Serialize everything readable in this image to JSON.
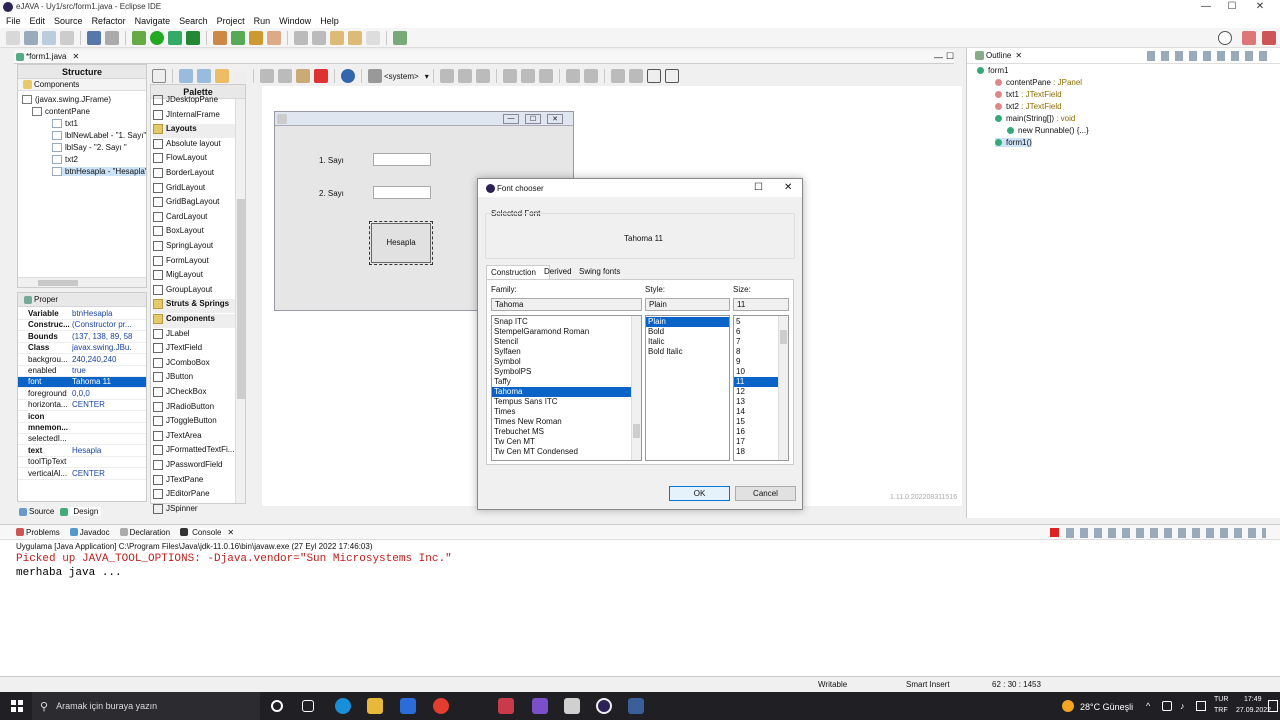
{
  "window": {
    "title": "eJAVA - Uy1/src/form1.java - Eclipse IDE",
    "min": "—",
    "max": "☐",
    "close": "✕"
  },
  "menu": [
    "File",
    "Edit",
    "Source",
    "Refactor",
    "Navigate",
    "Search",
    "Project",
    "Run",
    "Window",
    "Help"
  ],
  "editor_tab": {
    "label": "*form1.java",
    "close": "✕"
  },
  "structure": {
    "title": "Structure",
    "components_label": "Components",
    "tree": [
      "(javax.swing.JFrame)",
      "contentPane",
      "txt1",
      "lblNewLabel - \"1. Sayı\"",
      "lblSay - \"2. Sayı \"",
      "txt2",
      "btnHesapla - \"Hesapla\""
    ]
  },
  "properties": {
    "title": "Proper",
    "rows": [
      {
        "k": "Variable",
        "v": "btnHesapla",
        "bold": true
      },
      {
        "k": "Construc...",
        "v": "(Constructor pr...",
        "bold": true
      },
      {
        "k": "Bounds",
        "v": "(137, 138, 89, 58)",
        "bold": true
      },
      {
        "k": "Class",
        "v": "javax.swing.JBu...",
        "bold": true
      },
      {
        "k": "backgrou...",
        "v": "240,240,240",
        "bold": false
      },
      {
        "k": "enabled",
        "v": "true",
        "bold": false
      },
      {
        "k": "font",
        "v": "Tahoma 11",
        "bold": false,
        "sel": true
      },
      {
        "k": "foreground",
        "v": "0,0,0",
        "bold": false
      },
      {
        "k": "horizonta...",
        "v": "CENTER",
        "bold": false
      },
      {
        "k": "icon",
        "v": "",
        "bold": true
      },
      {
        "k": "mnemon...",
        "v": "",
        "bold": true
      },
      {
        "k": "selectedI...",
        "v": "",
        "bold": false
      },
      {
        "k": "text",
        "v": "Hesapla",
        "bold": true
      },
      {
        "k": "toolTipText",
        "v": "",
        "bold": false
      },
      {
        "k": "verticalAl...",
        "v": "CENTER",
        "bold": false
      }
    ]
  },
  "bottom_tabs": {
    "source": "Source",
    "design": "Design"
  },
  "toolbar_system": "<system>",
  "palette": {
    "title": "Palette",
    "items": [
      {
        "label": "JDesktopPane",
        "cat": false
      },
      {
        "label": "JInternalFrame",
        "cat": false
      },
      {
        "label": "Layouts",
        "cat": true
      },
      {
        "label": "Absolute layout",
        "cat": false
      },
      {
        "label": "FlowLayout",
        "cat": false
      },
      {
        "label": "BorderLayout",
        "cat": false
      },
      {
        "label": "GridLayout",
        "cat": false
      },
      {
        "label": "GridBagLayout",
        "cat": false
      },
      {
        "label": "CardLayout",
        "cat": false
      },
      {
        "label": "BoxLayout",
        "cat": false
      },
      {
        "label": "SpringLayout",
        "cat": false
      },
      {
        "label": "FormLayout",
        "cat": false
      },
      {
        "label": "MigLayout",
        "cat": false
      },
      {
        "label": "GroupLayout",
        "cat": false
      },
      {
        "label": "Struts & Springs",
        "cat": true
      },
      {
        "label": "Components",
        "cat": true
      },
      {
        "label": "JLabel",
        "cat": false
      },
      {
        "label": "JTextField",
        "cat": false
      },
      {
        "label": "JComboBox",
        "cat": false
      },
      {
        "label": "JButton",
        "cat": false
      },
      {
        "label": "JCheckBox",
        "cat": false
      },
      {
        "label": "JRadioButton",
        "cat": false
      },
      {
        "label": "JToggleButton",
        "cat": false
      },
      {
        "label": "JTextArea",
        "cat": false
      },
      {
        "label": "JFormattedTextFi...",
        "cat": false
      },
      {
        "label": "JPasswordField",
        "cat": false
      },
      {
        "label": "JTextPane",
        "cat": false
      },
      {
        "label": "JEditorPane",
        "cat": false
      },
      {
        "label": "JSpinner",
        "cat": false
      }
    ]
  },
  "jframe": {
    "label1": "1. Sayı",
    "label2": "2. Sayı",
    "button": "Hesapla"
  },
  "font_chooser": {
    "title": "Font chooser",
    "selected_font_label": "Selected Font",
    "preview": "Tahoma 11",
    "tabs": [
      "Construction",
      "Derived",
      "Swing fonts"
    ],
    "family_label": "Family:",
    "style_label": "Style:",
    "size_label": "Size:",
    "family_value": "Tahoma",
    "style_value": "Plain",
    "size_value": "11",
    "families": [
      "Snap ITC",
      "StempelGaramond Roman",
      "Stencil",
      "Sylfaen",
      "Symbol",
      "SymbolPS",
      "Taffy",
      "Tahoma",
      "Tempus Sans ITC",
      "Times",
      "Times New Roman",
      "Trebuchet MS",
      "Tw Cen MT",
      "Tw Cen MT Condensed"
    ],
    "family_selected": 7,
    "styles": [
      "Plain",
      "Bold",
      "Italic",
      "Bold Italic"
    ],
    "style_selected": 0,
    "sizes": [
      "5",
      "6",
      "7",
      "8",
      "9",
      "10",
      "11",
      "12",
      "13",
      "14",
      "15",
      "16",
      "17",
      "18"
    ],
    "size_selected": 6,
    "ok": "OK",
    "cancel": "Cancel"
  },
  "version_text": "1.11.0.202208311516",
  "outline": {
    "title": "Outline",
    "items": [
      {
        "text": "form1",
        "type": ""
      },
      {
        "text": "contentPane",
        "type": " : JPanel"
      },
      {
        "text": "txt1",
        "type": " : JTextField"
      },
      {
        "text": "txt2",
        "type": " : JTextField"
      },
      {
        "text": "main(String[])",
        "type": " : void"
      },
      {
        "text": "new Runnable() {...}",
        "type": ""
      },
      {
        "text": "form1()",
        "type": ""
      }
    ]
  },
  "console": {
    "tabs": [
      "Problems",
      "Javadoc",
      "Declaration",
      "Console"
    ],
    "launch": "Uygulama [Java Application] C:\\Program Files\\Java\\jdk-11.0.16\\bin\\javaw.exe (27 Eyl 2022 17:46:03)",
    "line1": "Picked up JAVA_TOOL_OPTIONS: -Djava.vendor=\"Sun Microsystems Inc.\"",
    "line2": "merhaba java ...",
    "err_color": "#c0201f"
  },
  "status": {
    "writable": "Writable",
    "insert": "Smart Insert",
    "pos": "62 : 30 : 1453"
  },
  "taskbar": {
    "search": "Aramak için buraya yazın",
    "weather": "28°C  Güneşli",
    "lang1": "TUR",
    "lang2": "TRF",
    "time": "17:49",
    "date": "27.09.2022"
  }
}
